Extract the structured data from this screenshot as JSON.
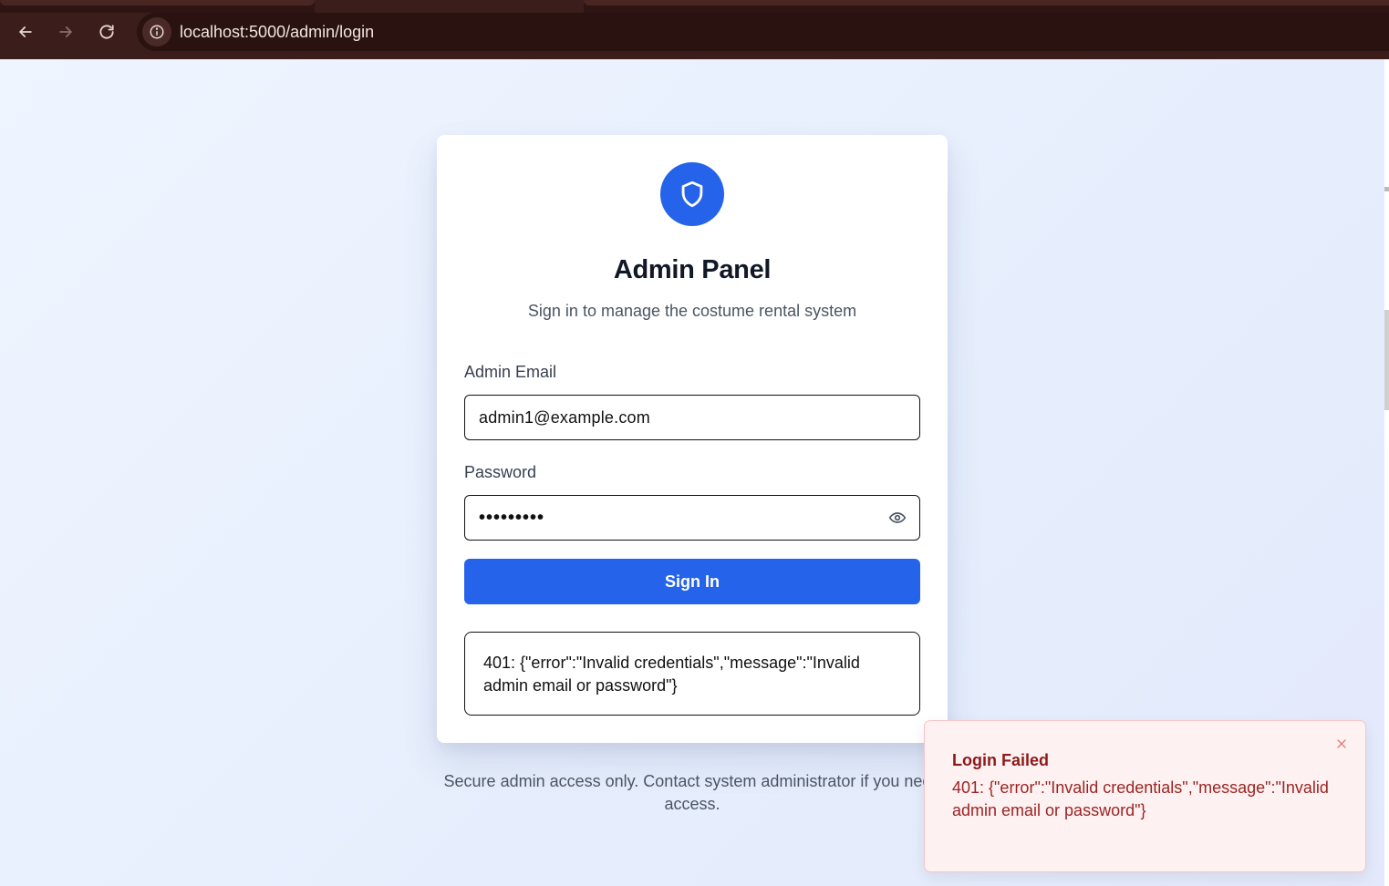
{
  "browser": {
    "url": "localhost:5000/admin/login"
  },
  "card": {
    "title": "Admin Panel",
    "subtitle": "Sign in to manage the costume rental system",
    "email_label": "Admin Email",
    "email_value": "admin1@example.com",
    "password_label": "Password",
    "password_value": "•••••••••",
    "signin_label": "Sign In",
    "error_text": "401: {\"error\":\"Invalid credentials\",\"message\":\"Invalid admin email or password\"}"
  },
  "footer": {
    "note": "Secure admin access only. Contact system administrator if you need access."
  },
  "toast": {
    "title": "Login Failed",
    "message": "401: {\"error\":\"Invalid credentials\",\"message\":\"Invalid admin email or password\"}"
  },
  "colors": {
    "accent": "#2563eb",
    "toast_bg": "#fef1f1",
    "toast_text": "#9b2424"
  },
  "icons": {
    "back": "arrow-left-icon",
    "forward": "arrow-right-icon",
    "reload": "reload-icon",
    "site_info": "info-icon",
    "logo": "shield-icon",
    "password_toggle": "eye-icon",
    "toast_close": "close-icon"
  }
}
